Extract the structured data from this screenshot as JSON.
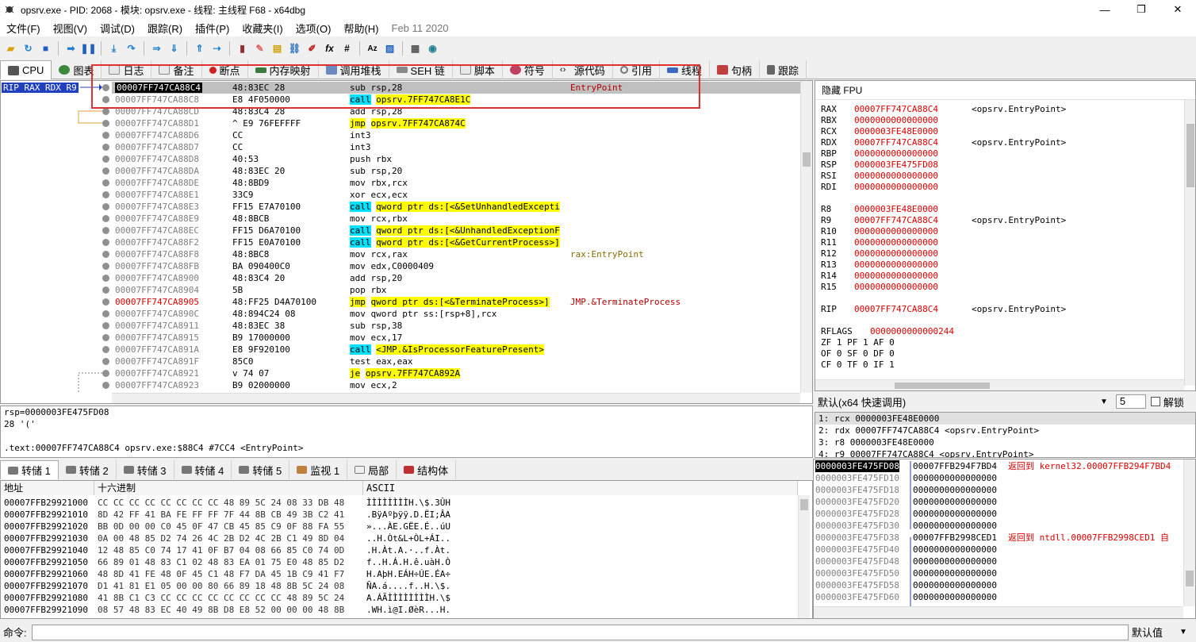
{
  "title": "opsrv.exe - PID: 2068 - 模块: opsrv.exe - 线程: 主线程 F68 - x64dbg",
  "winbtns": [
    "—",
    "❐",
    "✕"
  ],
  "menu": [
    "文件(F)",
    "视图(V)",
    "调试(D)",
    "跟踪(R)",
    "插件(P)",
    "收藏夹(I)",
    "选项(O)",
    "帮助(H)",
    "Feb 11 2020"
  ],
  "tabs": [
    "CPU",
    "图表",
    "日志",
    "备注",
    "断点",
    "内存映射",
    "调用堆栈",
    "SEH 链",
    "脚本",
    "符号",
    "源代码",
    "引用",
    "线程",
    "句柄",
    "跟踪"
  ],
  "rip_label": "RIP RAX RDX R9",
  "disasm": [
    {
      "a": "00007FF747CA88C4",
      "b": "48:83EC 28",
      "c": "sub rsp,28",
      "d": "EntryPoint",
      "cur": true
    },
    {
      "a": "00007FF747CA88C8",
      "b": "E8 4F050000",
      "c": "call opsrv.7FF747CA8E1C",
      "d": ""
    },
    {
      "a": "00007FF747CA88CD",
      "b": "48:83C4 28",
      "c": "add rsp,28",
      "d": ""
    },
    {
      "a": "00007FF747CA88D1",
      "b": "^ E9 76FEFFFF",
      "c": "jmp opsrv.7FF747CA874C",
      "d": ""
    },
    {
      "a": "00007FF747CA88D6",
      "b": "CC",
      "c": "int3",
      "d": ""
    },
    {
      "a": "00007FF747CA88D7",
      "b": "CC",
      "c": "int3",
      "d": ""
    },
    {
      "a": "00007FF747CA88D8",
      "b": "40:53",
      "c": "push rbx",
      "d": ""
    },
    {
      "a": "00007FF747CA88DA",
      "b": "48:83EC 20",
      "c": "sub rsp,20",
      "d": ""
    },
    {
      "a": "00007FF747CA88DE",
      "b": "48:8BD9",
      "c": "mov rbx,rcx",
      "d": ""
    },
    {
      "a": "00007FF747CA88E1",
      "b": "33C9",
      "c": "xor ecx,ecx",
      "d": ""
    },
    {
      "a": "00007FF747CA88E3",
      "b": "FF15 E7A70100",
      "c": "call qword ptr ds:[<&SetUnhandledExcepti",
      "d": ""
    },
    {
      "a": "00007FF747CA88E9",
      "b": "48:8BCB",
      "c": "mov rcx,rbx",
      "d": ""
    },
    {
      "a": "00007FF747CA88EC",
      "b": "FF15 D6A70100",
      "c": "call qword ptr ds:[<&UnhandledExceptionF",
      "d": ""
    },
    {
      "a": "00007FF747CA88F2",
      "b": "FF15 E0A70100",
      "c": "call qword ptr ds:[<&GetCurrentProcess>]",
      "d": ""
    },
    {
      "a": "00007FF747CA88F8",
      "b": "48:8BC8",
      "c": "mov rcx,rax",
      "d": "rax:EntryPoint"
    },
    {
      "a": "00007FF747CA88FB",
      "b": "BA 090400C0",
      "c": "mov edx,C0000409",
      "d": ""
    },
    {
      "a": "00007FF747CA8900",
      "b": "48:83C4 20",
      "c": "add rsp,20",
      "d": ""
    },
    {
      "a": "00007FF747CA8904",
      "b": "5B",
      "c": "pop rbx",
      "d": ""
    },
    {
      "a": "00007FF747CA8905",
      "b": "48:FF25 D4A70100",
      "c": "jmp qword ptr ds:[<&TerminateProcess>]",
      "d": "JMP.&TerminateProcess",
      "red": true
    },
    {
      "a": "00007FF747CA890C",
      "b": "48:894C24 08",
      "c": "mov qword ptr ss:[rsp+8],rcx",
      "d": ""
    },
    {
      "a": "00007FF747CA8911",
      "b": "48:83EC 38",
      "c": "sub rsp,38",
      "d": ""
    },
    {
      "a": "00007FF747CA8915",
      "b": "B9 17000000",
      "c": "mov ecx,17",
      "d": ""
    },
    {
      "a": "00007FF747CA891A",
      "b": "E8 9F920100",
      "c": "call <JMP.&IsProcessorFeaturePresent>",
      "d": ""
    },
    {
      "a": "00007FF747CA891F",
      "b": "85C0",
      "c": "test eax,eax",
      "d": ""
    },
    {
      "a": "00007FF747CA8921",
      "b": "v 74 07",
      "c": "je opsrv.7FF747CA892A",
      "d": ""
    },
    {
      "a": "00007FF747CA8923",
      "b": "B9 02000000",
      "c": "mov ecx,2",
      "d": ""
    }
  ],
  "regs_header": "隐藏 FPU",
  "regs": [
    {
      "n": "RAX",
      "v": "00007FF747CA88C4",
      "c": "<opsrv.EntryPoint>"
    },
    {
      "n": "RBX",
      "v": "0000000000000000",
      "c": ""
    },
    {
      "n": "RCX",
      "v": "0000003FE48E0000",
      "c": ""
    },
    {
      "n": "RDX",
      "v": "00007FF747CA88C4",
      "c": "<opsrv.EntryPoint>"
    },
    {
      "n": "RBP",
      "v": "0000000000000000",
      "c": ""
    },
    {
      "n": "RSP",
      "v": "0000003FE475FD08",
      "c": ""
    },
    {
      "n": "RSI",
      "v": "0000000000000000",
      "c": ""
    },
    {
      "n": "RDI",
      "v": "0000000000000000",
      "c": ""
    },
    {
      "n": "",
      "v": "",
      "c": ""
    },
    {
      "n": "R8",
      "v": "0000003FE48E0000",
      "c": ""
    },
    {
      "n": "R9",
      "v": "00007FF747CA88C4",
      "c": "<opsrv.EntryPoint>"
    },
    {
      "n": "R10",
      "v": "0000000000000000",
      "c": ""
    },
    {
      "n": "R11",
      "v": "0000000000000000",
      "c": ""
    },
    {
      "n": "R12",
      "v": "0000000000000000",
      "c": ""
    },
    {
      "n": "R13",
      "v": "0000000000000000",
      "c": ""
    },
    {
      "n": "R14",
      "v": "0000000000000000",
      "c": ""
    },
    {
      "n": "R15",
      "v": "0000000000000000",
      "c": ""
    },
    {
      "n": "",
      "v": "",
      "c": ""
    },
    {
      "n": "RIP",
      "v": "00007FF747CA88C4",
      "c": "<opsrv.EntryPoint>"
    },
    {
      "n": "",
      "v": "",
      "c": ""
    },
    {
      "n": "RFLAGS",
      "v": "0000000000000244",
      "c": ""
    }
  ],
  "flags": [
    "ZF 1  PF 1  AF 0",
    "OF 0  SF 0  DF 0",
    "CF 0  TF 0  IF 1"
  ],
  "callconv": {
    "label": "默认(x64 快速调用)",
    "count": "5",
    "unlock": "解锁"
  },
  "args": [
    "1: rcx 0000003FE48E0000",
    "2: rdx 00007FF747CA88C4 <opsrv.EntryPoint>",
    "3: r8 0000003FE48E0000",
    "4: r9 00007FF747CA88C4 <opsrv.EntryPoint>"
  ],
  "info": [
    "rsp=0000003FE475FD08",
    "28 '('",
    "",
    ".text:00007FF747CA88C4 opsrv.exe:$88C4 #7CC4 <EntryPoint>"
  ],
  "dump_tabs": [
    "转储 1",
    "转储 2",
    "转储 3",
    "转储 4",
    "转储 5",
    "监视 1",
    "局部",
    "结构体"
  ],
  "dump_headers": [
    "地址",
    "十六进制",
    "ASCII"
  ],
  "dump": [
    {
      "a": "00007FFB29921000",
      "h": "CC CC CC CC CC CC CC CC 48 89 5C 24 08 33 DB 48",
      "c": "ÌÌÌÌÌÌÌÌH.\\$.3ÛH"
    },
    {
      "a": "00007FFB29921010",
      "h": "8D 42 FF 41 BA FE FF FF 7F 44 8B CB 49 3B C2 41",
      "c": ".BÿAºþÿÿ.D.ËI;ÂA"
    },
    {
      "a": "00007FFB29921020",
      "h": "BB 0D 00 00 C0 45 0F 47 CB 45 85 C9 0F 88 FA 55",
      "c": "»...ÀE.GËE.É..úU"
    },
    {
      "a": "00007FFB29921030",
      "h": "0A 00 48 85 D2 74 26 4C 2B D2 4C 2B C1 49 8D 04",
      "c": "..H.Òt&L+ÒL+ÁI.."
    },
    {
      "a": "00007FFB29921040",
      "h": "12 48 85 C0 74 17 41 0F B7 04 08 66 85 C0 74 0D",
      "c": ".H.Àt.A.·..f.Àt."
    },
    {
      "a": "00007FFB29921050",
      "h": "66 89 01 48 83 C1 02 48 83 EA 01 75 E0 48 85 D2",
      "c": "f..H.Á.H.ê.uàH.Ò"
    },
    {
      "a": "00007FFB29921060",
      "h": "48 8D 41 FE 48 0F 45 C1 48 F7 DA 45 1B C9 41 F7",
      "c": "H.AþH.EÁH÷ÚE.ÉA÷"
    },
    {
      "a": "00007FFB29921070",
      "h": "D1 41 81 E1 05 00 00 80 66 89 18 48 8B 5C 24 08",
      "c": "ÑA.á....f..H.\\$."
    },
    {
      "a": "00007FFB29921080",
      "h": "41 8B C1 C3 CC CC CC CC CC CC CC CC 48 89 5C 24",
      "c": "A.ÁÃÌÌÌÌÌÌÌÌH.\\$"
    },
    {
      "a": "00007FFB29921090",
      "h": "08 57 48 83 EC 40 49 8B D8 E8 52 00 00 00 48 8B",
      "c": ".WH.ì@I.ØèR...H."
    }
  ],
  "stack": [
    {
      "a": "0000003FE475FD08",
      "v": "00007FFB294F7BD4",
      "c": "返回到 kernel32.00007FFB294F7BD4",
      "cur": true
    },
    {
      "a": "0000003FE475FD10",
      "v": "0000000000000000",
      "c": ""
    },
    {
      "a": "0000003FE475FD18",
      "v": "0000000000000000",
      "c": ""
    },
    {
      "a": "0000003FE475FD20",
      "v": "0000000000000000",
      "c": ""
    },
    {
      "a": "0000003FE475FD28",
      "v": "0000000000000000",
      "c": ""
    },
    {
      "a": "0000003FE475FD30",
      "v": "0000000000000000",
      "c": ""
    },
    {
      "a": "0000003FE475FD38",
      "v": "00007FFB2998CED1",
      "c": "返回到 ntdll.00007FFB2998CED1 自"
    },
    {
      "a": "0000003FE475FD40",
      "v": "0000000000000000",
      "c": ""
    },
    {
      "a": "0000003FE475FD48",
      "v": "0000000000000000",
      "c": ""
    },
    {
      "a": "0000003FE475FD50",
      "v": "0000000000000000",
      "c": ""
    },
    {
      "a": "0000003FE475FD58",
      "v": "0000000000000000",
      "c": ""
    },
    {
      "a": "0000003FE475FD60",
      "v": "0000000000000000",
      "c": ""
    }
  ],
  "cmd": {
    "label": "命令:",
    "default": "默认值"
  }
}
